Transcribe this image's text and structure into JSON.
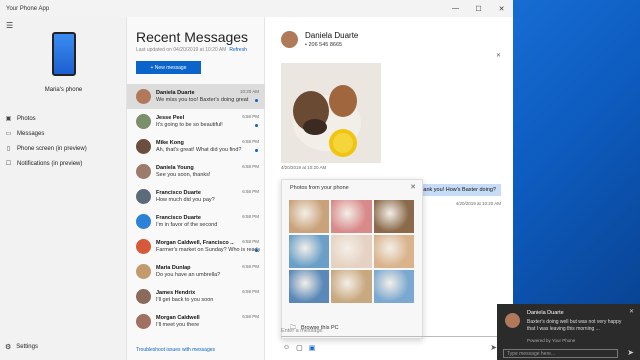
{
  "app": {
    "title": "Your Phone App",
    "window_controls": [
      "—",
      "☐",
      "✕"
    ]
  },
  "sidebar": {
    "phone_name": "Maria's phone",
    "items": [
      {
        "icon": "photos-icon",
        "glyph": "▣",
        "label": "Photos"
      },
      {
        "icon": "messages-icon",
        "glyph": "▭",
        "label": "Messages"
      },
      {
        "icon": "phone-screen-icon",
        "glyph": "▯",
        "label": "Phone screen (in preview)"
      },
      {
        "icon": "notifications-icon",
        "glyph": "☐",
        "label": "Notifications (in preview)"
      }
    ],
    "settings_label": "Settings"
  },
  "list": {
    "title": "Recent Messages",
    "last_updated": "Last updated on 04/20/2019 at 10:20 AM",
    "refresh_label": "Refresh",
    "new_message_label": "+ New message",
    "conversations": [
      {
        "name": "Daniela Duarte",
        "preview": "We miss you too! Baxter's doing great",
        "time": "10:20 AM",
        "color": "#b07a5a",
        "selected": true,
        "unread": true
      },
      {
        "name": "Jesse Peel",
        "preview": "It's going to be so beautiful!",
        "time": "6:58 PM",
        "color": "#7a8f6a",
        "selected": false,
        "unread": true
      },
      {
        "name": "Mike Kong",
        "preview": "Ah, that's great! What did you find?",
        "time": "6:58 PM",
        "color": "#6b4e3d",
        "selected": false,
        "unread": true
      },
      {
        "name": "Daniela Young",
        "preview": "See you soon, thanks!",
        "time": "6:58 PM",
        "color": "#9a7b6c",
        "selected": false,
        "unread": false
      },
      {
        "name": "Francisco Duarte",
        "preview": "How much did you pay?",
        "time": "6:58 PM",
        "color": "#5c6b7a",
        "selected": false,
        "unread": false
      },
      {
        "name": "Francisco Duarte",
        "preview": "I'm in favor of the second",
        "time": "6:58 PM",
        "color": "#2c82d6",
        "selected": false,
        "unread": false
      },
      {
        "name": "Morgan Caldwell, Francisco ...",
        "preview": "Farmer's market on Sunday? Who is ready for it?",
        "time": "6:58 PM",
        "color": "#d65a3a",
        "selected": false,
        "unread": true
      },
      {
        "name": "Maria Dunlap",
        "preview": "Do you have an umbrella?",
        "time": "6:58 PM",
        "color": "#c49a6c",
        "selected": false,
        "unread": false
      },
      {
        "name": "James Hendrix",
        "preview": "I'll get back to you soon",
        "time": "6:58 PM",
        "color": "#8a6a5a",
        "selected": false,
        "unread": false
      },
      {
        "name": "Morgan Caldwell",
        "preview": "I'll meet you there",
        "time": "6:58 PM",
        "color": "#a07060",
        "selected": false,
        "unread": false
      }
    ],
    "troubleshoot_label": "Troubleshoot issues with messages"
  },
  "chat": {
    "contact_name": "Daniela Duarte",
    "contact_phone": "• 206 545 8665",
    "photo_timestamp": "4/20/2019 at 10:20 AM",
    "outgoing_message": "Thank you! How's Baxter doing?",
    "outgoing_timestamp": "4/20/2019 at 10:20 AM",
    "composer_placeholder": "Enter a message",
    "photo_picker": {
      "title": "Photos from your phone",
      "browse_label": "Browse this PC",
      "thumbnails": [
        "#c9a27a",
        "#d88a8a",
        "#8a6a4a",
        "#6aa0c8",
        "#e6d2c2",
        "#d9b38c",
        "#5a88b8",
        "#c8a87e",
        "#7aa8d0"
      ]
    }
  },
  "toast": {
    "name": "Daniela Duarte",
    "message": "Baxter's doing well but was not very happy that I was leaving this morning ...",
    "powered_by": "Powered by Your Phone",
    "reply_placeholder": "Type message here..."
  },
  "colors": {
    "accent": "#0a64c9",
    "selected_row": "#dcdcdc",
    "outgoing_bubble": "#c6dcf7"
  }
}
